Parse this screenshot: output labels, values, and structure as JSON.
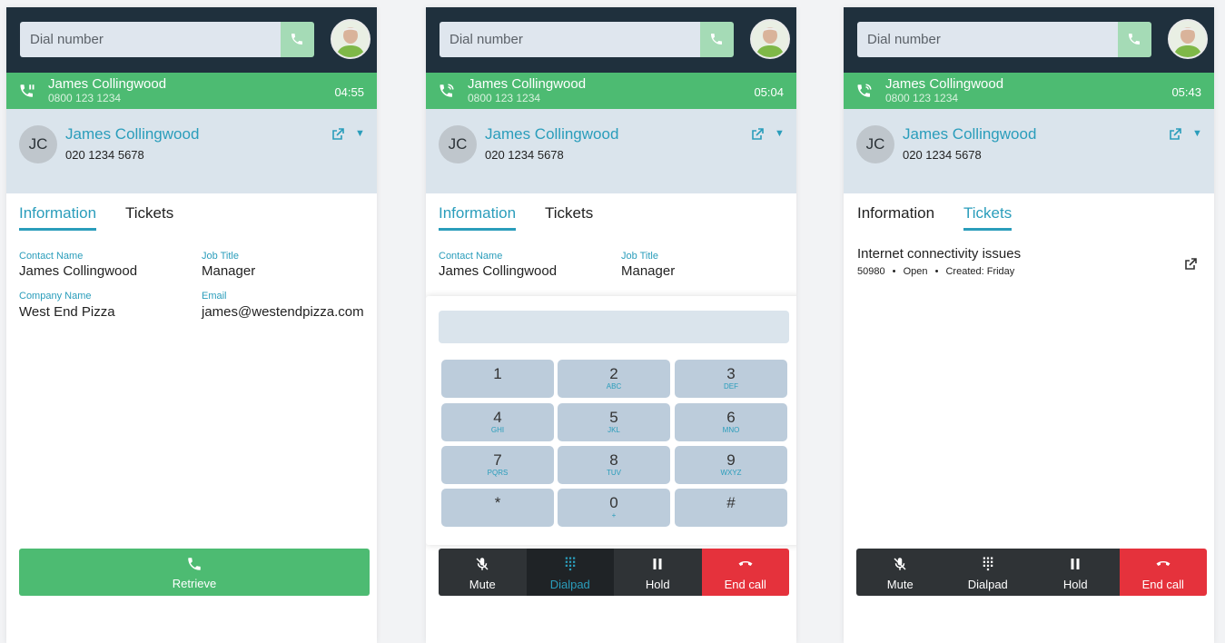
{
  "panels": [
    {
      "dial_placeholder": "Dial number",
      "call": {
        "name": "James Collingwood",
        "number": "0800 123 1234",
        "timer": "04:55",
        "state": "held"
      },
      "contact": {
        "initials": "JC",
        "name": "James Collingwood",
        "phone": "020 1234 5678"
      },
      "tabs": [
        "Information",
        "Tickets"
      ],
      "active_tab": "Information",
      "fields": [
        {
          "label": "Contact Name",
          "value": "James Collingwood"
        },
        {
          "label": "Job Title",
          "value": "Manager"
        },
        {
          "label": "Company Name",
          "value": "West End Pizza"
        },
        {
          "label": "Email",
          "value": "james@westendpizza.com"
        }
      ],
      "action": "Retrieve"
    },
    {
      "dial_placeholder": "Dial number",
      "call": {
        "name": "James Collingwood",
        "number": "0800 123 1234",
        "timer": "05:04",
        "state": "active"
      },
      "contact": {
        "initials": "JC",
        "name": "James Collingwood",
        "phone": "020 1234 5678"
      },
      "tabs": [
        "Information",
        "Tickets"
      ],
      "active_tab": "Information",
      "fields": [
        {
          "label": "Contact Name",
          "value": "James Collingwood"
        },
        {
          "label": "Job Title",
          "value": "Manager"
        }
      ],
      "dialpad": {
        "keys": [
          {
            "num": "1",
            "letters": ""
          },
          {
            "num": "2",
            "letters": "ABC"
          },
          {
            "num": "3",
            "letters": "DEF"
          },
          {
            "num": "4",
            "letters": "GHI"
          },
          {
            "num": "5",
            "letters": "JKL"
          },
          {
            "num": "6",
            "letters": "MNO"
          },
          {
            "num": "7",
            "letters": "PQRS"
          },
          {
            "num": "8",
            "letters": "TUV"
          },
          {
            "num": "9",
            "letters": "WXYZ"
          },
          {
            "num": "*",
            "letters": ""
          },
          {
            "num": "0",
            "letters": "+"
          },
          {
            "num": "#",
            "letters": ""
          }
        ]
      },
      "controls": [
        {
          "label": "Mute",
          "icon": "mic-off-icon"
        },
        {
          "label": "Dialpad",
          "icon": "dialpad-icon",
          "active": true
        },
        {
          "label": "Hold",
          "icon": "pause-icon"
        },
        {
          "label": "End call",
          "icon": "hangup-icon"
        }
      ]
    },
    {
      "dial_placeholder": "Dial number",
      "call": {
        "name": "James Collingwood",
        "number": "0800 123 1234",
        "timer": "05:43",
        "state": "active"
      },
      "contact": {
        "initials": "JC",
        "name": "James Collingwood",
        "phone": "020 1234 5678"
      },
      "tabs": [
        "Information",
        "Tickets"
      ],
      "active_tab": "Tickets",
      "ticket": {
        "title": "Internet connectivity issues",
        "id": "50980",
        "status": "Open",
        "created": "Created: Friday",
        "separator": "•"
      },
      "controls": [
        {
          "label": "Mute",
          "icon": "mic-off-icon"
        },
        {
          "label": "Dialpad",
          "icon": "dialpad-icon"
        },
        {
          "label": "Hold",
          "icon": "pause-icon"
        },
        {
          "label": "End call",
          "icon": "hangup-icon"
        }
      ]
    }
  ],
  "colors": {
    "header": "#1f303d",
    "green": "#4dbb72",
    "accent": "#2a9dbb",
    "contact_bg": "#dae4ec",
    "end_call": "#e5323c"
  }
}
